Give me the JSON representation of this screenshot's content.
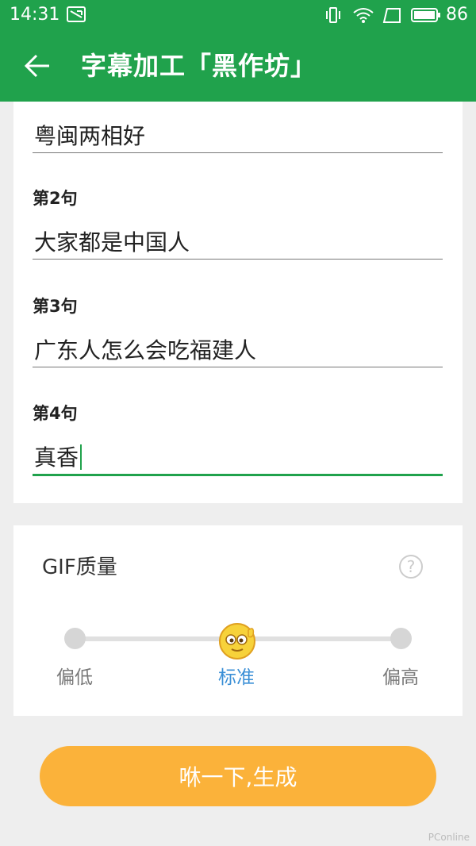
{
  "status_bar": {
    "time": "14:31",
    "battery": "86"
  },
  "app_bar": {
    "title": "字幕加工「黑作坊」"
  },
  "fields": [
    {
      "label": "",
      "value": "粤闽两相好"
    },
    {
      "label": "第2句",
      "value": "大家都是中国人"
    },
    {
      "label": "第3句",
      "value": "广东人怎么会吃福建人"
    },
    {
      "label": "第4句",
      "value": "真香"
    }
  ],
  "quality": {
    "title": "GIF质量",
    "options": [
      "偏低",
      "标准",
      "偏高"
    ],
    "selected": "标准",
    "level_fraction": 0.5,
    "selected_color": "#3a8fd6"
  },
  "action": {
    "label": "咻一下,生成",
    "color": "#fbb23a"
  },
  "watermark": "PConline",
  "theme": {
    "primary": "#20a24c"
  }
}
